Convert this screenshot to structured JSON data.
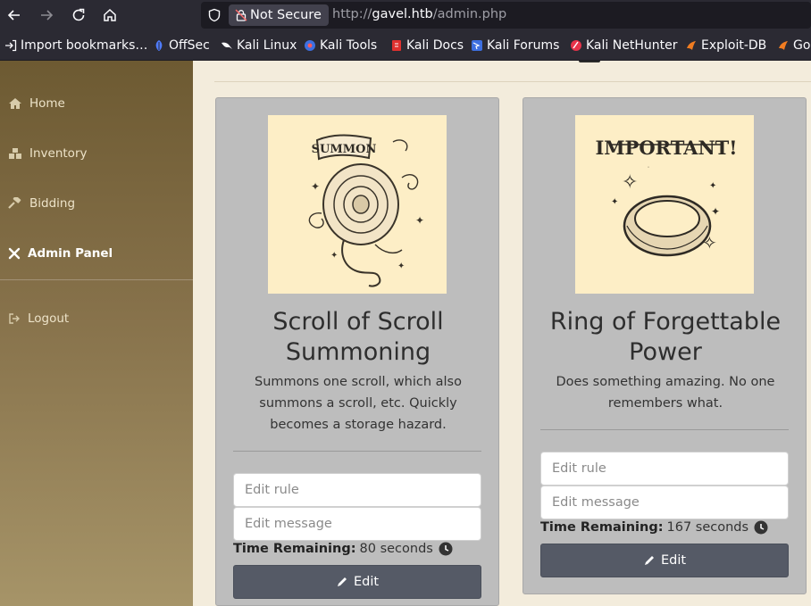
{
  "browser": {
    "security_label": "Not Secure",
    "url_prefix": "http://",
    "url_domain": "gavel.htb",
    "url_path": "/admin.php"
  },
  "bookmarks": [
    {
      "label": "Import bookmarks…",
      "icon": "import-icon"
    },
    {
      "label": "OffSec",
      "icon": "offsec-icon"
    },
    {
      "label": "Kali Linux",
      "icon": "kali-dragon-icon"
    },
    {
      "label": "Kali Tools",
      "icon": "kali-tools-icon"
    },
    {
      "label": "Kali Docs",
      "icon": "kali-docs-icon"
    },
    {
      "label": "Kali Forums",
      "icon": "kali-forums-icon"
    },
    {
      "label": "Kali NetHunter",
      "icon": "nethunter-icon"
    },
    {
      "label": "Exploit-DB",
      "icon": "exploitdb-icon"
    },
    {
      "label": "Go",
      "icon": "ghdb-icon"
    }
  ],
  "sidebar": {
    "items": [
      {
        "label": "Home",
        "icon": "home-icon"
      },
      {
        "label": "Inventory",
        "icon": "boxes-icon"
      },
      {
        "label": "Bidding",
        "icon": "gavel-icon"
      },
      {
        "label": "Admin Panel",
        "icon": "tools-icon",
        "active": true
      },
      {
        "label": "Logout",
        "icon": "sign-out-icon"
      }
    ]
  },
  "cards": [
    {
      "title": "Scroll of Scroll Summoning",
      "description": "Summons one scroll, which also summons a scroll, etc. Quickly becomes a storage hazard.",
      "image_text": "SUMMON",
      "image_icon": "scroll-illustration",
      "rule_placeholder": "Edit rule",
      "message_placeholder": "Edit message",
      "time_label": "Time Remaining:",
      "time_value": "80 seconds",
      "edit_label": "Edit"
    },
    {
      "title": "Ring of Forgettable Power",
      "description": "Does something amazing. No one remembers what.",
      "image_text": "IMPORTANT!",
      "image_icon": "ring-illustration",
      "rule_placeholder": "Edit rule",
      "message_placeholder": "Edit message",
      "time_label": "Time Remaining:",
      "time_value": "167 seconds",
      "edit_label": "Edit"
    }
  ],
  "colors": {
    "sidebar_top": "#6d5a32",
    "sidebar_bottom": "#a69468",
    "card_bg": "#bdbdbd",
    "button_bg": "#555a66",
    "image_bg": "#fdeec6",
    "page_bg": "#f3ecdc"
  }
}
